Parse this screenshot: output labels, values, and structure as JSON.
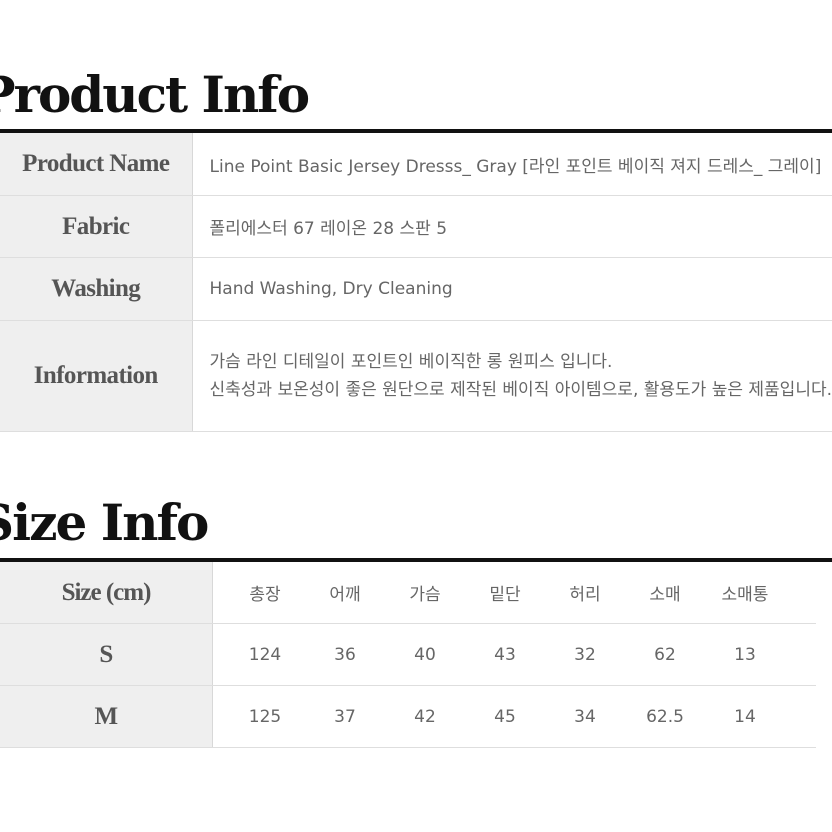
{
  "product_info": {
    "title": "Product Info",
    "rows": [
      {
        "label": "Product Name",
        "value": "Line Point Basic Jersey Dresss_ Gray [라인 포인트 베이직 져지 드레스_ 그레이]"
      },
      {
        "label": "Fabric",
        "value": "폴리에스터 67 레이온 28 스판 5"
      },
      {
        "label": "Washing",
        "value": "Hand Washing, Dry Cleaning"
      },
      {
        "label": "Information",
        "lines": [
          "가슴 라인 디테일이 포인트인 베이직한 롱 원피스 입니다.",
          "신축성과 보온성이 좋은 원단으로 제작된 베이직 아이템으로, 활용도가 높은 제품입니다."
        ]
      }
    ]
  },
  "size_info": {
    "title": "Size Info",
    "header_label": "Size (cm)",
    "columns": [
      "총장",
      "어깨",
      "가슴",
      "밑단",
      "허리",
      "소매",
      "소매통"
    ],
    "rows": [
      {
        "size": "S",
        "values": [
          "124",
          "36",
          "40",
          "43",
          "32",
          "62",
          "13"
        ]
      },
      {
        "size": "M",
        "values": [
          "125",
          "37",
          "42",
          "45",
          "34",
          "62.5",
          "14"
        ]
      }
    ]
  }
}
